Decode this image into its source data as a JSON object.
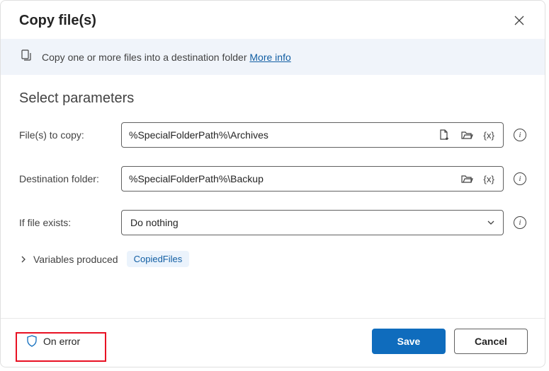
{
  "dialog": {
    "title": "Copy file(s)",
    "close_icon": "close"
  },
  "banner": {
    "description": "Copy one or more files into a destination folder ",
    "more_info": "More info"
  },
  "section": {
    "title": "Select parameters"
  },
  "fields": {
    "files": {
      "label": "File(s) to copy:",
      "value": "%SpecialFolderPath%\\Archives"
    },
    "destination": {
      "label": "Destination folder:",
      "value": "%SpecialFolderPath%\\Backup"
    },
    "if_exists": {
      "label": "If file exists:",
      "value": "Do nothing"
    }
  },
  "vars": {
    "label": "Variables produced",
    "chip": "CopiedFiles"
  },
  "footer": {
    "on_error": "On error",
    "save": "Save",
    "cancel": "Cancel"
  },
  "tokens": {
    "var": "{x}"
  }
}
